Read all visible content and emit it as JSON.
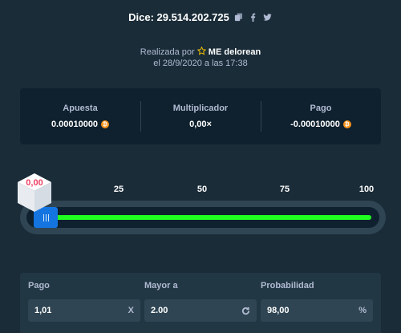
{
  "header": {
    "title": "Dice: 29.514.202.725",
    "icons": [
      "copy-icon",
      "facebook-icon",
      "twitter-icon"
    ]
  },
  "byline": {
    "line1_prefix": "Realizada por",
    "username": "ME delorean",
    "line2": "el 28/9/2020 a las 17:38"
  },
  "stats": {
    "bet_label": "Apuesta",
    "bet_value": "0.00010000",
    "multiplier_label": "Multiplicador",
    "multiplier_value": "0,00×",
    "payout_label": "Pago",
    "payout_value": "-0.00010000",
    "currency_icon": "bitcoin-icon"
  },
  "slider": {
    "ticks": [
      "25",
      "50",
      "75",
      "100"
    ],
    "result": "0,00",
    "threshold_fraction": 0.02,
    "colors": {
      "win": "#1fff20",
      "thumb": "#1475e1",
      "result": "#ed4163"
    }
  },
  "inputs": {
    "payout_label": "Pago",
    "payout_value": "1,01",
    "payout_suffix": "X",
    "roll_over_label": "Mayor a",
    "roll_over_value": "2.00",
    "roll_over_suffix_icon": "refresh-icon",
    "chance_label": "Probabilidad",
    "chance_value": "98,00",
    "chance_suffix": "%"
  }
}
